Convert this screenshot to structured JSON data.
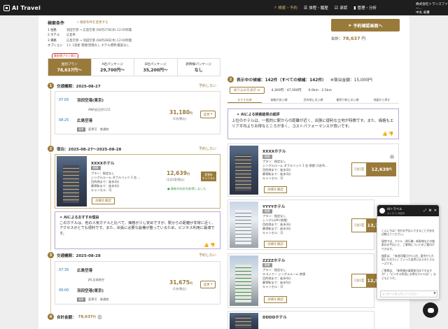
{
  "app": {
    "name": "AI Travel"
  },
  "nav": [
    {
      "label": "検索・予約",
      "icon": "search-icon"
    },
    {
      "label": "旅程・履歴",
      "icon": "list-icon"
    },
    {
      "label": "承認",
      "icon": "check-icon"
    },
    {
      "label": "管理・分析",
      "icon": "bar-chart-icon"
    }
  ],
  "company": {
    "line1": "株式会社トランスファー...",
    "line2": "中丸 竜實"
  },
  "conditions": {
    "title": "検索条件",
    "change": "検索条件を変更する",
    "rows": [
      {
        "k": "1 往路",
        "v": "羽田空港 → 広島空港 (08月27日(水) 12:00到着"
      },
      {
        "k": "2 ホテル",
        "v": "広島県"
      },
      {
        "k": "3 帰路",
        "v": "広島空港 → 羽田空港 (08月28日(木) 12:00到着"
      },
      {
        "k": "オプション",
        "v": "1人 1部屋 喫煙/禁煙なし ホテル標準/最安なし"
      }
    ]
  },
  "confirm_button": "予約確認画面へ",
  "total_top": {
    "label": "合計：",
    "value": "78,637",
    "unit": "円"
  },
  "flag": "最安値プラン表示",
  "tabs": [
    {
      "name": "個別プラン",
      "value": "78,637円〜"
    },
    {
      "name": "A社パッケージ",
      "value": "29,700円〜"
    },
    {
      "name": "B社パッケージ",
      "value": "35,200円〜"
    },
    {
      "name": "新幹線パッケージ",
      "value": "なし"
    }
  ],
  "sections": {
    "s1": {
      "num": "1",
      "title": "交通機関：2025-08-27",
      "nores": "予約しない"
    },
    "s2": {
      "num": "2",
      "title": "宿泊：2025-08-27〜2025-08-28",
      "nores": "予約しない"
    },
    "s3": {
      "num": "3",
      "title": "交通機関：2025-08-28",
      "nores": "予約しない"
    }
  },
  "flight1": {
    "dep_time": "07:05",
    "dep_place": "羽田空港(東京)",
    "airline": "ANA全日空1111",
    "arr_time": "08:25",
    "arr_place": "広島空港",
    "tag": "座席",
    "seat": "変更可　普通席",
    "price": "31,180",
    "unit": "円",
    "per": "(1名/税込)",
    "change": "変更"
  },
  "hotel_left": {
    "name": "XXXXホテル",
    "tag": "朝食",
    "info": [
      "プラン：指定なし",
      "シングルルーム ダブルベッド 1 台 ...",
      "目的地まで：徒歩3分",
      "最寄駅まで：徒歩3分",
      "キャンセル：可"
    ],
    "price": "12,639",
    "unit": "円",
    "per": "(1泊1室/税込)",
    "badge_line1": "変更料",
    "badge_line2": "キャンセル",
    "note": "最新の料金を取得しました",
    "detail": "詳細を確認"
  },
  "ai_reason": {
    "title": "AIによるおすすめ理由",
    "body": "このホテルは、他の人気ホテルと比べて、価格が少し安めですが、駅からの距離が非常に近く、アクセスがとても便利です。また、出張に必要な設備が整っているため、ビジネス利用に最適です。"
  },
  "flight2": {
    "dep_time": "07:35",
    "dep_place": "広島空港",
    "airline": "JAL日本航空",
    "arr_time": "09:00",
    "arr_place": "羽田空港(東京)",
    "tag": "座席",
    "seat": "変更可　普通席",
    "price": "31,675",
    "unit": "円",
    "per": "(1名/税込)",
    "change": "変更"
  },
  "total_bottom": {
    "num": "4",
    "label": "合計金額：",
    "value": "78,637",
    "unit": "円"
  },
  "results": {
    "num": "2",
    "title": "表示中の候補：142件（すべての候補：142件）",
    "lowest": "※宿泊金額：15,000円",
    "filter": "絞り込みを表示",
    "price_range": "4,300円 - 47,500円",
    "distance": "0.0km - 2.5km",
    "sort": [
      "おすすめ順",
      "価格が安い順",
      "目的地に近い順",
      "最寄り駅に近い順",
      "地図から探す"
    ]
  },
  "ai_summary": {
    "title": "AIによる検索結果の総評",
    "body": "上位のホテルは、一般的に駅からの距離が近く、出張に便利な立地が特徴です。また、価格もエリア平均よりお得なところが多く、コストパフォーマンスが良いです。"
  },
  "hotel_results": [
    {
      "name": "XXXXホテル",
      "tag": "朝食",
      "info": [
        "プラン：指定なし",
        "シングルルーム ダブルベッド 1 台 禁煙 (1名/8...",
        "目的地まで：徒歩3分",
        "最寄駅まで：徒歩3分",
        "キャンセル：可"
      ],
      "detail": "詳細を確認",
      "label": "1泊1室",
      "price": "12,639",
      "unit": "円"
    },
    {
      "name": "YYYYホテル",
      "tag": "朝食",
      "info": [
        "プラン：指定なし",
        "シングルLM (禁煙)",
        "目的地まで：徒歩3分",
        "最寄駅まで：徒歩3分",
        "キャンセル：可"
      ],
      "detail": "詳細を確認",
      "label": "1泊1室",
      "price": "13,750",
      "unit": "円"
    },
    {
      "name": "ZZZZホテル",
      "tag": "朝食",
      "info": [
        "プラン：指定なし",
        "エコノミー シングルルーム 禁煙",
        "目的地まで：徒歩4分",
        "最寄駅まで：徒歩5分",
        "キャンセル：可"
      ],
      "detail": "詳細を確認",
      "label": "1泊1室",
      "price": "12,900",
      "unit": "円"
    },
    {
      "name": "DDDDホテル"
    }
  ],
  "chat": {
    "name": "AIトラベル",
    "sub": "オンライン対応中",
    "msg1": "こんにちは！何かお手伝いできることがあれば教えてください。",
    "msg2": "現地では、ホテル・飛行機・新幹線などの検索のお手伝いと、ご質問についてのご案内ができます。",
    "msg3": "検索は、「来週月曜日から2泊、東京から大阪に行きたい」といった自然に伝えるとスムーズです。",
    "msg4": "ご質問は、「新幹線の乗車前日はできますか？」「ビジネス利用にお得なホテルは？」などもどうぞ。",
    "placeholder": "メッセージを入力してください"
  }
}
